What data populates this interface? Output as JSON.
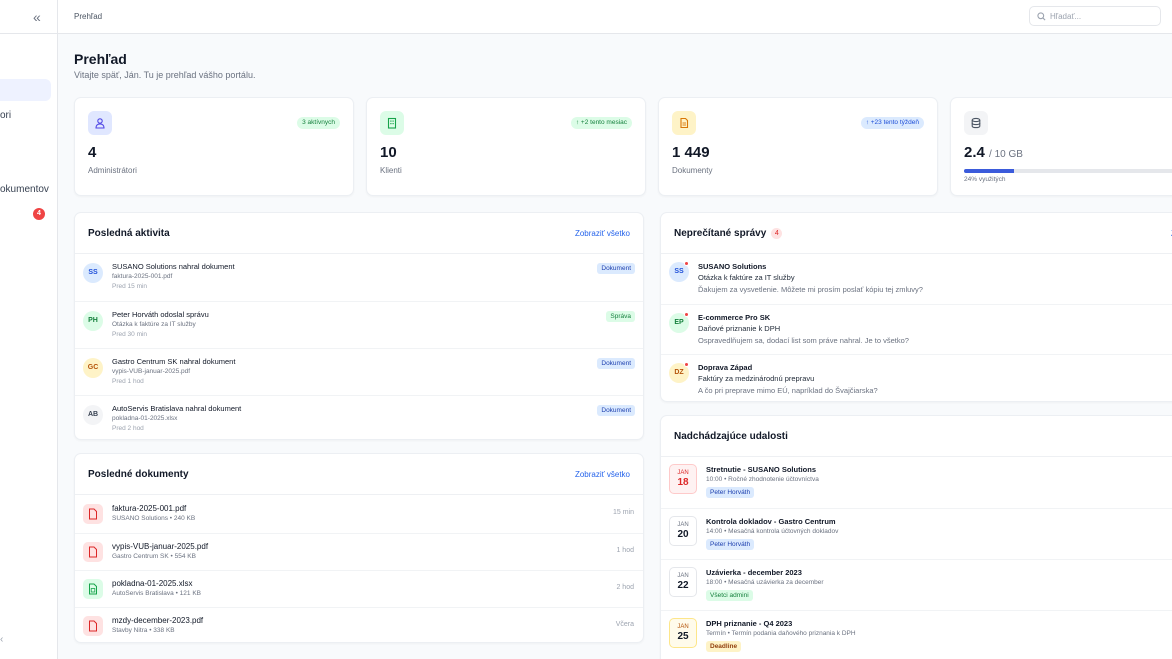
{
  "sidebar": {
    "collapse_icon": "«",
    "items": [
      {
        "label": "ori"
      },
      {
        "label": "okumentov"
      },
      {
        "label": ""
      }
    ],
    "badge": "4"
  },
  "header": {
    "breadcrumb": "Prehľad",
    "search_placeholder": "Hľadať..."
  },
  "page": {
    "title": "Prehľad",
    "subtitle": "Vitajte späť, Ján. Tu je prehľad vášho portálu."
  },
  "stats": [
    {
      "icon": "users-icon",
      "value": "4",
      "label": "Administrátori",
      "badge": "3 aktívnych"
    },
    {
      "icon": "building-icon",
      "value": "10",
      "label": "Klienti",
      "badge": "↑ +2 tento mesiac"
    },
    {
      "icon": "document-icon",
      "value": "1 449",
      "label": "Dokumenty",
      "badge": "↑ +23 tento týždeň"
    },
    {
      "icon": "database-icon",
      "value": "2.4",
      "unit": "/ 10 GB",
      "usage_label": "24% využitých",
      "usage_percent": 24
    }
  ],
  "activity": {
    "title": "Posledná aktivita",
    "link": "Zobraziť všetko",
    "items": [
      {
        "initials": "SS",
        "actor": "SUSANO Solutions",
        "action": "nahral dokument",
        "detail": "faktura-2025-001.pdf",
        "time": "Pred 15 min",
        "tag": "Dokument"
      },
      {
        "initials": "PH",
        "actor": "Peter Horváth",
        "action": "odoslal správu",
        "detail": "Otázka k faktúre za IT služby",
        "time": "Pred 30 min",
        "tag": "Správa"
      },
      {
        "initials": "GC",
        "actor": "Gastro Centrum SK",
        "action": "nahral dokument",
        "detail": "vypis-VUB-januar-2025.pdf",
        "time": "Pred 1 hod",
        "tag": "Dokument"
      },
      {
        "initials": "AB",
        "actor": "AutoServis Bratislava",
        "action": "nahral dokument",
        "detail": "pokladna-01-2025.xlsx",
        "time": "Pred 2 hod",
        "tag": "Dokument"
      }
    ]
  },
  "documents": {
    "title": "Posledné dokumenty",
    "link": "Zobraziť všetko",
    "items": [
      {
        "name": "faktura-2025-001.pdf",
        "meta": "SUSANO Solutions • 240 KB",
        "time": "15 min",
        "type": "pdf"
      },
      {
        "name": "vypis-VUB-januar-2025.pdf",
        "meta": "Gastro Centrum SK • 554 KB",
        "time": "1 hod",
        "type": "pdf"
      },
      {
        "name": "pokladna-01-2025.xlsx",
        "meta": "AutoServis Bratislava • 121 KB",
        "time": "2 hod",
        "type": "xlsx"
      },
      {
        "name": "mzdy-december-2023.pdf",
        "meta": "Stavby Nitra • 338 KB",
        "time": "Včera",
        "type": "pdf"
      }
    ]
  },
  "messages": {
    "title": "Neprečítané správy",
    "count": "4",
    "link": "Zo",
    "items": [
      {
        "initials": "SS",
        "from": "SUSANO Solutions",
        "subject": "Otázka k faktúre za IT služby",
        "preview": "Ďakujem za vysvetlenie. Môžete mi prosím poslať kópiu tej zmluvy?"
      },
      {
        "initials": "EP",
        "from": "E-commerce Pro SK",
        "subject": "Daňové priznanie k DPH",
        "preview": "Ospravedlňujem sa, dodací list som práve nahral. Je to všetko?"
      },
      {
        "initials": "DZ",
        "from": "Doprava Západ",
        "subject": "Faktúry za medzinárodnú prepravu",
        "preview": "A čo pri preprave mimo EÚ, napríklad do Švajčiarska?"
      }
    ]
  },
  "events": {
    "title": "Nadchádzajúce udalosti",
    "items": [
      {
        "month": "JAN",
        "day": "18",
        "title": "Stretnutie - SUSANO Solutions",
        "meta": "10:00 • Ročné zhodnotenie účtovníctva",
        "tag": "Peter Horváth"
      },
      {
        "month": "JAN",
        "day": "20",
        "title": "Kontrola dokladov - Gastro Centrum",
        "meta": "14:00 • Mesačná kontrola účtovných dokladov",
        "tag": "Peter Horváth"
      },
      {
        "month": "JAN",
        "day": "22",
        "title": "Uzávierka - december 2023",
        "meta": "18:00 • Mesačná uzávierka za december",
        "tag": "Všetci admini"
      },
      {
        "month": "JAN",
        "day": "25",
        "title": "DPH priznanie - Q4 2023",
        "meta": "Termín • Termín podania daňového priznania k DPH",
        "tag": "Deadline"
      }
    ]
  },
  "colors": {
    "accent": "#2563eb",
    "danger": "#ef4444",
    "success": "#16a34a",
    "warning": "#d97706"
  }
}
